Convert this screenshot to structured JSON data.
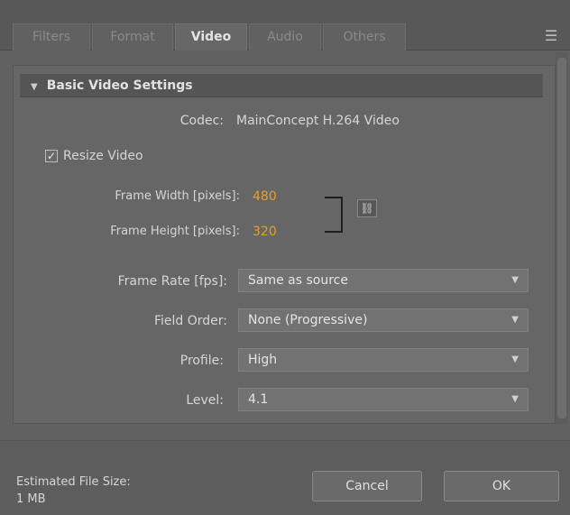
{
  "tabs": [
    {
      "label": "Filters"
    },
    {
      "label": "Format"
    },
    {
      "label": "Video"
    },
    {
      "label": "Audio"
    },
    {
      "label": "Others"
    }
  ],
  "tab_menu_icon": "panel-menu-icon",
  "section": {
    "title": "Basic Video Settings"
  },
  "codec": {
    "label": "Codec:",
    "value": "MainConcept H.264 Video"
  },
  "resize": {
    "label": "Resize Video",
    "checked": true,
    "check_glyph": "✓"
  },
  "frame_width": {
    "label": "Frame Width [pixels]:",
    "value": "480"
  },
  "frame_height": {
    "label": "Frame Height [pixels]:",
    "value": "320"
  },
  "link_icon": "chain-link-icon",
  "fields": {
    "frame_rate": {
      "label": "Frame Rate [fps]:",
      "value": "Same as source"
    },
    "field_order": {
      "label": "Field Order:",
      "value": "None (Progressive)"
    },
    "profile": {
      "label": "Profile:",
      "value": "High"
    },
    "level": {
      "label": "Level:",
      "value": "4.1"
    }
  },
  "footer": {
    "estimate_label": "Estimated File Size:",
    "estimate_value": "1 MB",
    "cancel": "Cancel",
    "ok": "OK"
  },
  "colors": {
    "accent_value": "#e5a02a",
    "background": "#616161"
  }
}
